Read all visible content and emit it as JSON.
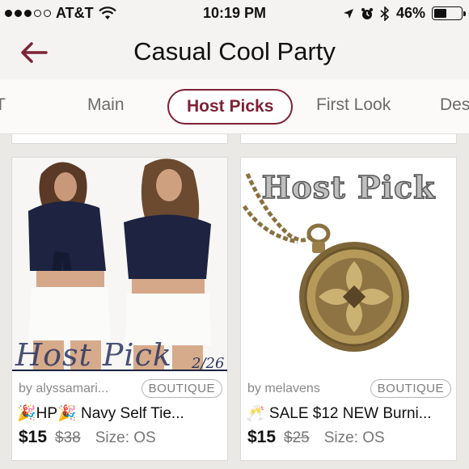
{
  "status_bar": {
    "carrier": "AT&T",
    "time": "10:19 PM",
    "battery": "46%",
    "battery_level": 0.46,
    "signal_bars_filled": 3,
    "signal_bars_total": 5
  },
  "nav": {
    "title": "Casual Cool Party",
    "accent_color": "#7d2235"
  },
  "tabs": [
    {
      "label": "T"
    },
    {
      "label": "Main"
    },
    {
      "label": "Host Picks",
      "active": true
    },
    {
      "label": "First Look"
    },
    {
      "label": "Des"
    }
  ],
  "listings": [
    {
      "seller": "by alyssamari...",
      "badge": "BOUTIQUE",
      "title": "🎉HP🎉 Navy Self Tie...",
      "price": "$15",
      "original_price": "$38",
      "size": "Size: OS",
      "image_caption": "Host Pick",
      "image_date": "2/26"
    },
    {
      "seller": "by melavens",
      "badge": "BOUTIQUE",
      "title": "🥂 SALE $12 NEW Burni...",
      "price": "$15",
      "original_price": "$25",
      "size": "Size: OS",
      "image_caption": "Host Pick"
    }
  ]
}
